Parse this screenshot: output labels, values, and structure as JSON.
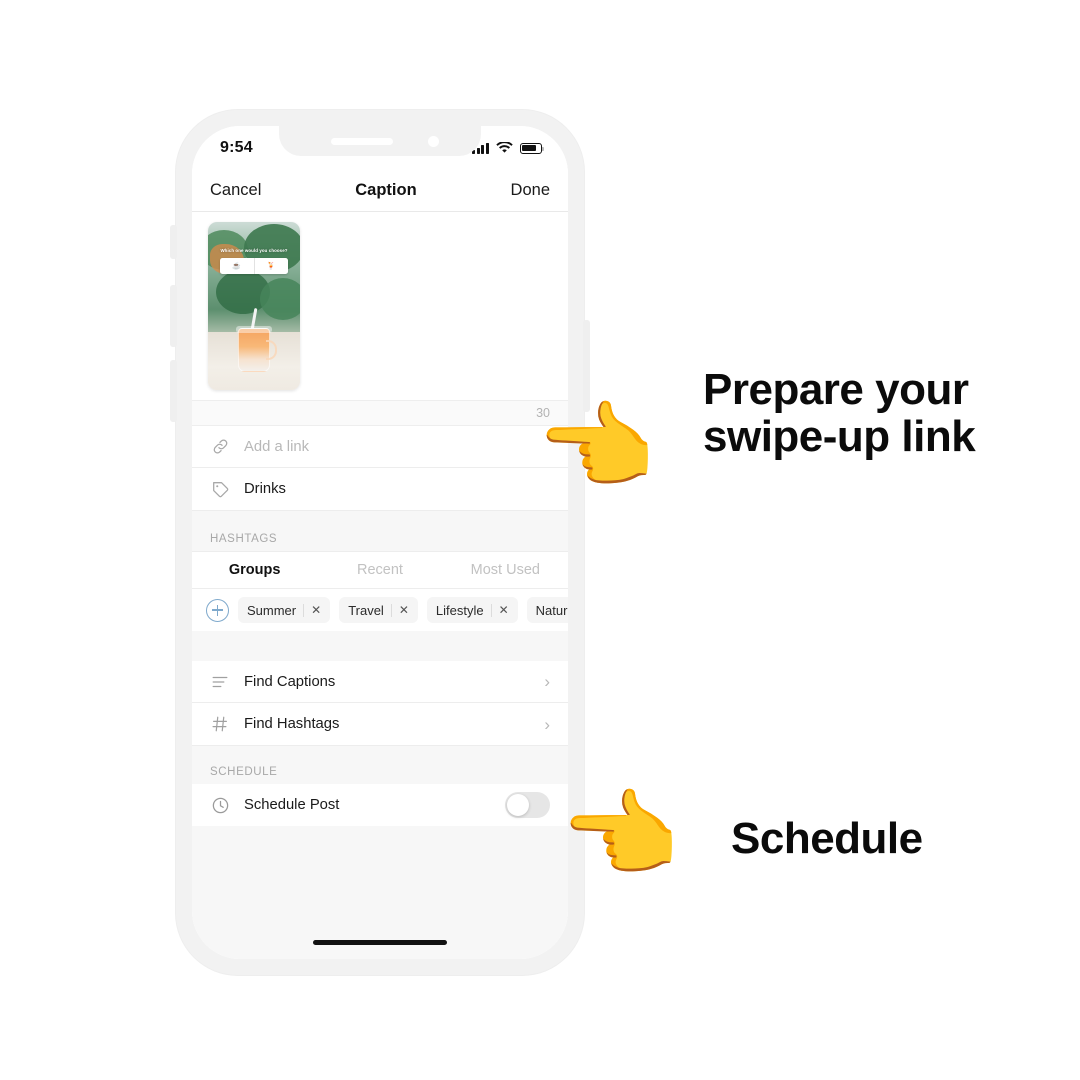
{
  "device": {
    "status_bar": {
      "time": "9:54",
      "signal_icon": "signal-bars-icon",
      "wifi_icon": "wifi-icon",
      "battery_icon": "battery-icon"
    },
    "nav": {
      "cancel_label": "Cancel",
      "title": "Caption",
      "done_label": "Done"
    }
  },
  "caption": {
    "text": "",
    "placeholder": "",
    "counter": "30",
    "thumbnail": {
      "poll_question": "Which one would you choose?",
      "poll_option_left": "☕",
      "poll_option_right": "🍹"
    }
  },
  "link_row": {
    "icon": "link-icon",
    "placeholder": "Add a link",
    "value": ""
  },
  "tag_row": {
    "icon": "tag-icon",
    "value": "Drinks"
  },
  "hashtags": {
    "section_label": "HASHTAGS",
    "tabs": [
      {
        "label": "Groups",
        "active": true
      },
      {
        "label": "Recent",
        "active": false
      },
      {
        "label": "Most Used",
        "active": false
      }
    ],
    "add_icon": "plus-circle-icon",
    "chips": [
      {
        "label": "Summer",
        "remove_icon": "close-icon"
      },
      {
        "label": "Travel",
        "remove_icon": "close-icon"
      },
      {
        "label": "Lifestyle",
        "remove_icon": "close-icon"
      },
      {
        "label": "Nature",
        "remove_icon": "close-icon"
      }
    ]
  },
  "tools": [
    {
      "icon": "list-lines-icon",
      "label": "Find Captions",
      "chevron": "›"
    },
    {
      "icon": "hash-icon",
      "label": "Find Hashtags",
      "chevron": "›"
    }
  ],
  "schedule": {
    "section_label": "SCHEDULE",
    "icon": "clock-icon",
    "label": "Schedule Post",
    "toggle_on": false
  },
  "annotations": [
    {
      "hand_icon": "pointing-left-hand-icon",
      "text": "Prepare your swipe-up link"
    },
    {
      "hand_icon": "pointing-left-hand-icon",
      "text": "Schedule"
    }
  ],
  "colors": {
    "accent_blue": "#7fa9cc",
    "hand_yellow": "#F5A623",
    "text": "#0b0b0b"
  }
}
